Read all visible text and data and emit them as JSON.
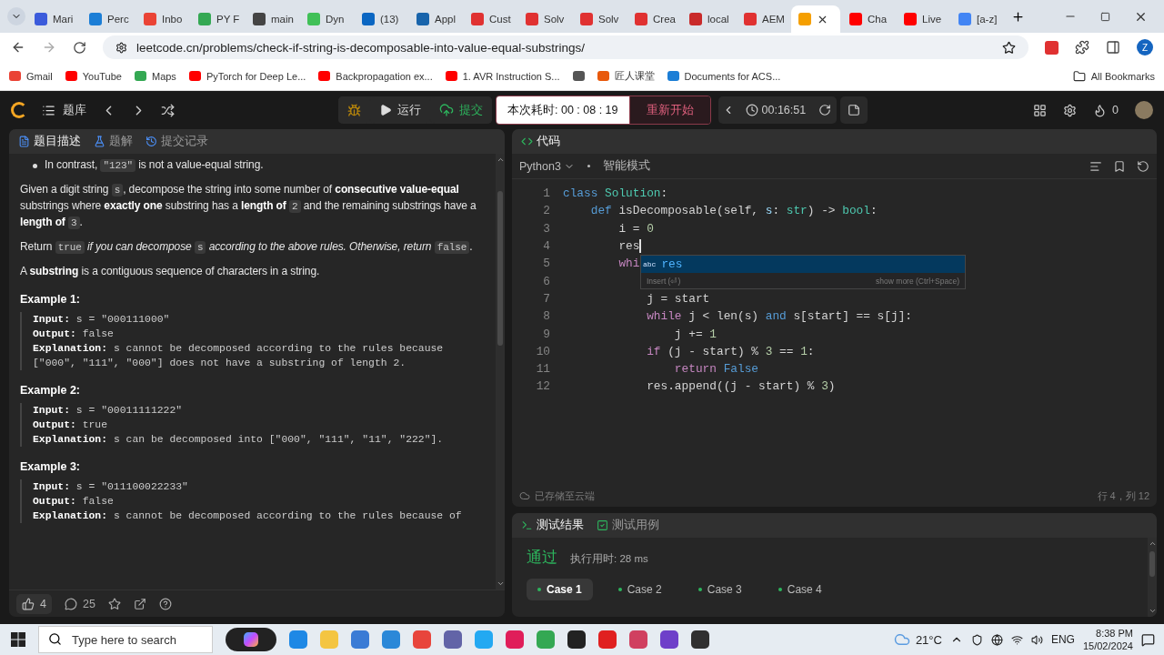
{
  "browser": {
    "tabs": [
      {
        "title": "Mari",
        "color": "#3b5bdb",
        "selected": false
      },
      {
        "title": "Perc",
        "color": "#1c7ed6",
        "selected": false
      },
      {
        "title": "Inbo",
        "color": "#ea4335",
        "selected": false
      },
      {
        "title": "PY F",
        "color": "#34a853",
        "selected": false
      },
      {
        "title": "main",
        "color": "#444444",
        "selected": false
      },
      {
        "title": "Dyn",
        "color": "#40c057",
        "selected": false
      },
      {
        "title": "(13)",
        "color": "#0a66c2",
        "selected": false
      },
      {
        "title": "Appl",
        "color": "#1864ab",
        "selected": false
      },
      {
        "title": "Cust",
        "color": "#e03131",
        "selected": false
      },
      {
        "title": "Solv",
        "color": "#e03131",
        "selected": false
      },
      {
        "title": "Solv",
        "color": "#e03131",
        "selected": false
      },
      {
        "title": "Crea",
        "color": "#e03131",
        "selected": false
      },
      {
        "title": "local",
        "color": "#c92a2a",
        "selected": false
      },
      {
        "title": "AEM",
        "color": "#e03131",
        "selected": false
      },
      {
        "color": "#f59f00",
        "selected": true
      },
      {
        "title": "Cha",
        "color": "#ff0000",
        "selected": false
      },
      {
        "title": "Live",
        "color": "#ff0000",
        "selected": false
      },
      {
        "title": "[a-z]",
        "color": "#4285f4",
        "selected": false
      }
    ],
    "address": "leetcode.cn/problems/check-if-string-is-decomposable-into-value-equal-substrings/",
    "profile_initial": "Z",
    "bookmarks": [
      {
        "title": "Gmail",
        "color": "#ea4335"
      },
      {
        "title": "YouTube",
        "color": "#ff0000"
      },
      {
        "title": "Maps",
        "color": "#34a853"
      },
      {
        "title": "PyTorch for Deep Le...",
        "color": "#ff0000"
      },
      {
        "title": "Backpropagation ex...",
        "color": "#ff0000"
      },
      {
        "title": "1. AVR Instruction S...",
        "color": "#ff0000"
      },
      {
        "color": "#555555"
      },
      {
        "title": "匠人课堂",
        "color": "#e8590c"
      },
      {
        "title": "Documents for ACS...",
        "color": "#1c7ed6"
      }
    ],
    "all_bookmarks": "All Bookmarks"
  },
  "app": {
    "nav_title": "题库",
    "run": "运行",
    "submit": "提交",
    "timer": "本次耗时: 00 : 08 : 19",
    "restart": "重新开始",
    "elapsed": "00:16:51",
    "flame_count": "0"
  },
  "description": {
    "tabs": [
      {
        "label": "题目描述",
        "selected": true
      },
      {
        "label": "题解",
        "selected": false
      },
      {
        "label": "提交记录",
        "selected": false
      }
    ],
    "paragraphs": [
      {
        "bullet": true,
        "segments": [
          {
            "kind": "text",
            "text": "In contrast, "
          },
          {
            "kind": "code",
            "text": "\"123\""
          },
          {
            "kind": "text",
            "text": " is not a value-equal string."
          }
        ]
      },
      {
        "bullet": false,
        "segments": [
          {
            "kind": "text",
            "text": "Given a digit string "
          },
          {
            "kind": "code",
            "text": "s"
          },
          {
            "kind": "text",
            "text": ", decompose the string into some number of **consecutive value-equal** substrings where **exactly one** substring has a **length of** "
          },
          {
            "kind": "code",
            "text": "2"
          },
          {
            "kind": "text",
            "text": " and the remaining substrings have a **length of** "
          },
          {
            "kind": "code",
            "text": "3"
          },
          {
            "kind": "text",
            "text": "."
          }
        ]
      },
      {
        "bullet": false,
        "segments": [
          {
            "kind": "text",
            "text": "Return "
          },
          {
            "kind": "code",
            "text": "true"
          },
          {
            "kind": "text",
            "text": " *if you can decompose* "
          },
          {
            "kind": "code",
            "text": "s"
          },
          {
            "kind": "text",
            "text": " *according to the above rules. Otherwise, return* "
          },
          {
            "kind": "code",
            "text": "false"
          },
          {
            "kind": "text",
            "text": "."
          }
        ]
      },
      {
        "bullet": false,
        "segments": [
          {
            "kind": "text",
            "text": "A **substring** is a contiguous sequence of characters in a string."
          }
        ]
      }
    ],
    "examples": [
      {
        "title": "Example 1:",
        "lines": [
          {
            "label": "Input:",
            "value": "s = \"000111000\""
          },
          {
            "label": "Output:",
            "value": "false"
          },
          {
            "label": "Explanation:",
            "value": "s cannot be decomposed according to the rules because [\"000\", \"111\", \"000\"] does not have a substring of length 2."
          }
        ]
      },
      {
        "title": "Example 2:",
        "lines": [
          {
            "label": "Input:",
            "value": "s = \"00011111222\""
          },
          {
            "label": "Output:",
            "value": "true"
          },
          {
            "label": "Explanation:",
            "value": "s can be decomposed into [\"000\", \"111\", \"11\", \"222\"]."
          }
        ]
      },
      {
        "title": "Example 3:",
        "lines": [
          {
            "label": "Input:",
            "value": "s = \"011100022233\""
          },
          {
            "label": "Output:",
            "value": "false"
          },
          {
            "label": "Explanation:",
            "value": "s cannot be decomposed according to the rules because of"
          }
        ]
      }
    ],
    "likes": "4",
    "comments": "25"
  },
  "editor": {
    "title": "代码",
    "language": "Python3",
    "mode": "智能模式",
    "lines": [
      {
        "number": "1",
        "cursor": false,
        "tokens": [
          {
            "kind": "kw",
            "t": "class "
          },
          {
            "kind": "type",
            "t": "Solution"
          },
          {
            "kind": "plain",
            "t": ":"
          }
        ]
      },
      {
        "number": "2",
        "cursor": false,
        "tokens": [
          {
            "kind": "kw",
            "t": "    def"
          },
          {
            "kind": "plain",
            "t": " isDecomposable(self, "
          },
          {
            "kind": "param",
            "t": "s"
          },
          {
            "kind": "plain",
            "t": ": "
          },
          {
            "kind": "type",
            "t": "str"
          },
          {
            "kind": "plain",
            "t": ") -> "
          },
          {
            "kind": "type",
            "t": "bool"
          },
          {
            "kind": "plain",
            "t": ":"
          }
        ]
      },
      {
        "number": "3",
        "cursor": false,
        "tokens": [
          {
            "kind": "plain",
            "t": "        i = "
          },
          {
            "kind": "num",
            "t": "0"
          }
        ]
      },
      {
        "number": "4",
        "cursor": true,
        "tokens": [
          {
            "kind": "plain",
            "t": "        res"
          }
        ]
      },
      {
        "number": "5",
        "cursor": false,
        "tokens": [
          {
            "kind": "ctrl",
            "t": "        whi"
          }
        ]
      },
      {
        "number": "6",
        "cursor": false
      },
      {
        "number": "7",
        "cursor": false,
        "tokens": [
          {
            "kind": "plain",
            "t": "            j = start"
          }
        ]
      },
      {
        "number": "8",
        "cursor": false,
        "tokens": [
          {
            "kind": "ctrl",
            "t": "            while"
          },
          {
            "kind": "plain",
            "t": " j < len(s) "
          },
          {
            "kind": "kw",
            "t": "and"
          },
          {
            "kind": "plain",
            "t": " s[start] == s[j]:"
          }
        ]
      },
      {
        "number": "9",
        "cursor": false,
        "tokens": [
          {
            "kind": "plain",
            "t": "                j += "
          },
          {
            "kind": "num",
            "t": "1"
          }
        ]
      },
      {
        "number": "10",
        "cursor": false,
        "tokens": [
          {
            "kind": "ctrl",
            "t": "            if"
          },
          {
            "kind": "plain",
            "t": " (j - start) % "
          },
          {
            "kind": "num",
            "t": "3"
          },
          {
            "kind": "plain",
            "t": " == "
          },
          {
            "kind": "num",
            "t": "1"
          },
          {
            "kind": "plain",
            "t": ":"
          }
        ]
      },
      {
        "number": "11",
        "cursor": false,
        "tokens": [
          {
            "kind": "ctrl",
            "t": "                return "
          },
          {
            "kind": "kw",
            "t": "False"
          }
        ]
      },
      {
        "number": "12",
        "cursor": false,
        "tokens": [
          {
            "kind": "plain",
            "t": "            res.append((j - start) % "
          },
          {
            "kind": "num",
            "t": "3"
          },
          {
            "kind": "plain",
            "t": ")"
          }
        ]
      }
    ],
    "autocomplete": {
      "icon_text": "abc",
      "item": "res",
      "hint": "Insert (⏎)",
      "more": "show more (Ctrl+Space)"
    },
    "save_status": "已存储至云端",
    "cursor_position": "行 4，列 12"
  },
  "results": {
    "tabs": [
      {
        "label": "测试结果",
        "selected": true
      },
      {
        "label": "测试用例",
        "selected": false
      }
    ],
    "status": "通过",
    "runtime": "执行用时: 28 ms",
    "cases": [
      {
        "label": "Case 1",
        "selected": true
      },
      {
        "label": "Case 2",
        "selected": false
      },
      {
        "label": "Case 3",
        "selected": false
      },
      {
        "label": "Case 4",
        "selected": false
      }
    ]
  },
  "taskbar": {
    "search_placeholder": "Type here to search",
    "apps": [
      {
        "color": "#1e88e5"
      },
      {
        "color": "#f4c542"
      },
      {
        "color": "#3a7bd5"
      },
      {
        "color": "#2b88d8"
      },
      {
        "color": "#e8453c"
      },
      {
        "color": "#6264a7"
      },
      {
        "color": "#23a9f2"
      },
      {
        "color": "#e01e5a"
      },
      {
        "color": "#34a853"
      },
      {
        "color": "#222222"
      },
      {
        "color": "#e02020"
      },
      {
        "color": "#d04060"
      },
      {
        "color": "#6e40c9"
      },
      {
        "color": "#303030"
      }
    ],
    "weather": "21°C",
    "language": "ENG",
    "time": "8:38 PM",
    "date": "15/02/2024"
  }
}
